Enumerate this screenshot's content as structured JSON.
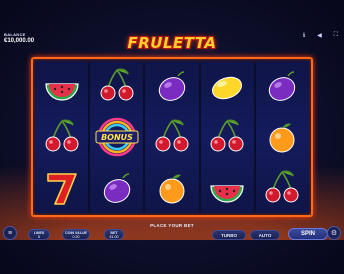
{
  "header": {
    "balance_label": "BALANCE",
    "balance_value": "€10,000.00",
    "logo": "FRULETTA",
    "icons": [
      "info-icon",
      "sound-icon",
      "fullscreen-icon"
    ]
  },
  "reels": [
    [
      "watermelon",
      "cherries",
      "seven"
    ],
    [
      "cherries",
      "bonus",
      "plum"
    ],
    [
      "plum",
      "cherries",
      "orange"
    ],
    [
      "lemon",
      "cherries",
      "watermelon"
    ],
    [
      "plum",
      "orange",
      "cherries"
    ]
  ],
  "bonus_label": "BONUS",
  "footer": {
    "message": "PLACE YOUR BET",
    "lines_label": "LINES",
    "lines_value": "5",
    "coin_value_label": "COIN VALUE",
    "coin_value": "0.20",
    "bet_label": "BET",
    "bet_value": "£1.00",
    "turbo_label": "TURBO",
    "auto_label": "AUTO",
    "spin_label": "SPIN"
  },
  "colors": {
    "frame": "#ff6a1a",
    "background": "#0d0f2a",
    "logo": "#ffcf2e"
  }
}
